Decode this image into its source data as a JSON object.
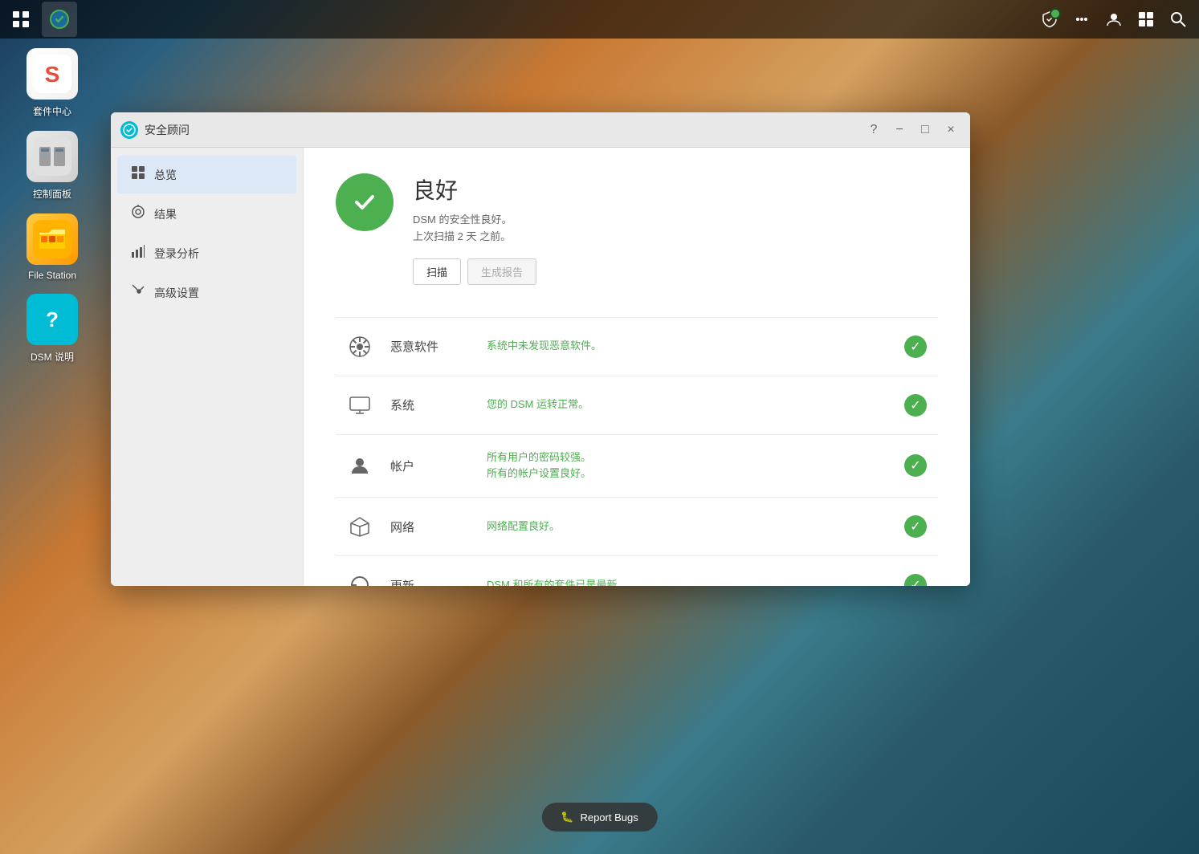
{
  "taskbar": {
    "left_icons": [
      {
        "id": "apps-icon",
        "symbol": "⊞",
        "active": false
      },
      {
        "id": "security-advisor-icon",
        "symbol": "🌐",
        "active": true
      }
    ],
    "right_icons": [
      {
        "id": "shield-status-icon",
        "symbol": "✓",
        "has_badge": true
      },
      {
        "id": "chat-icon",
        "symbol": "💬",
        "has_badge": false
      },
      {
        "id": "user-icon",
        "symbol": "👤",
        "has_badge": false
      },
      {
        "id": "grid-icon",
        "symbol": "⊞",
        "has_badge": false
      },
      {
        "id": "search-icon",
        "symbol": "🔍",
        "has_badge": false
      }
    ]
  },
  "desktop": {
    "icons": [
      {
        "id": "package-center",
        "label": "套件中心",
        "bg": "pkg"
      },
      {
        "id": "control-panel",
        "label": "控制面板",
        "bg": "ctrl"
      },
      {
        "id": "file-station",
        "label": "File Station",
        "bg": "file"
      },
      {
        "id": "dsm-help",
        "label": "DSM 说明",
        "bg": "help"
      }
    ]
  },
  "dialog": {
    "title": "安全顾问",
    "help_label": "?",
    "minimize_label": "−",
    "maximize_label": "□",
    "close_label": "×",
    "sidebar": {
      "items": [
        {
          "id": "overview",
          "label": "总览",
          "icon": "dashboard",
          "active": true
        },
        {
          "id": "results",
          "label": "结果",
          "icon": "target",
          "active": false
        },
        {
          "id": "login-analysis",
          "label": "登录分析",
          "icon": "bar-chart",
          "active": false
        },
        {
          "id": "advanced-settings",
          "label": "高级设置",
          "icon": "wrench",
          "active": false
        }
      ]
    },
    "main": {
      "status": {
        "level": "良好",
        "desc_line1": "DSM 的安全性良好。",
        "desc_line2": "上次扫描 2 天 之前。",
        "scan_button": "扫描",
        "report_button": "生成报告"
      },
      "security_items": [
        {
          "id": "malware",
          "icon": "biohazard",
          "name": "恶意软件",
          "desc": "系统中未发现恶意软件。",
          "ok": true
        },
        {
          "id": "system",
          "icon": "monitor",
          "name": "系统",
          "desc": "您的 DSM 运转正常。",
          "ok": true
        },
        {
          "id": "account",
          "icon": "user",
          "name": "帐户",
          "desc_line1": "所有用户的密码较强。",
          "desc_line2": "所有的帐户设置良好。",
          "ok": true
        },
        {
          "id": "network",
          "icon": "home",
          "name": "网络",
          "desc": "网络配置良好。",
          "ok": true
        },
        {
          "id": "updates",
          "icon": "refresh",
          "name": "更新",
          "desc": "DSM 和所有的套件已是最新。",
          "ok": true
        }
      ]
    }
  },
  "report_bugs": {
    "label": "Report Bugs"
  }
}
